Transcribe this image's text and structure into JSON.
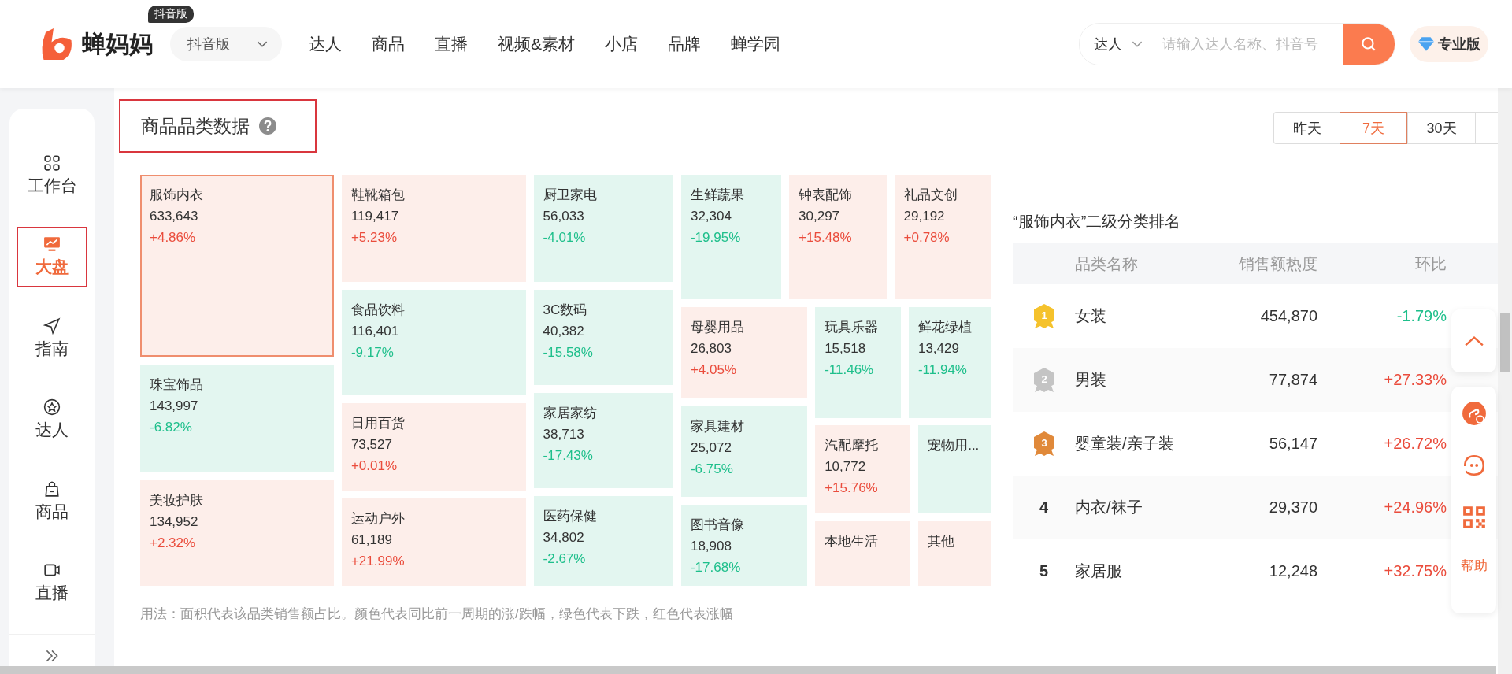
{
  "header": {
    "logo_text": "蝉妈妈",
    "logo_badge": "抖音版",
    "platform_select": "抖音版",
    "nav": [
      {
        "label": "达人"
      },
      {
        "label": "商品"
      },
      {
        "label": "直播"
      },
      {
        "label": "视频&素材"
      },
      {
        "label": "小店"
      },
      {
        "label": "品牌"
      },
      {
        "label": "蝉学园"
      }
    ],
    "search": {
      "scope": "达人",
      "placeholder": "请输入达人名称、抖音号"
    },
    "pro_button": "专业版"
  },
  "sidebar": {
    "items": [
      {
        "label": "工作台",
        "selected": false
      },
      {
        "label": "大盘",
        "selected": true
      },
      {
        "label": "指南",
        "selected": false
      },
      {
        "label": "达人",
        "selected": false
      },
      {
        "label": "商品",
        "selected": false
      },
      {
        "label": "直播",
        "selected": false
      }
    ]
  },
  "section": {
    "title": "商品品类数据",
    "highlighted": true,
    "periods": [
      {
        "label": "昨天",
        "selected": false
      },
      {
        "label": "7天",
        "selected": true
      },
      {
        "label": "30天",
        "selected": false
      }
    ]
  },
  "treemap": {
    "tiles": [
      {
        "name": "服饰内衣",
        "value": "633,643",
        "change": "+4.86%",
        "color": "#fdeeea",
        "selected": true
      },
      {
        "name": "珠宝饰品",
        "value": "143,997",
        "change": "-6.82%",
        "color": "#e3f6f0",
        "selected": false
      },
      {
        "name": "美妆护肤",
        "value": "134,952",
        "change": "+2.32%",
        "color": "#fdeeea",
        "selected": false
      },
      {
        "name": "鞋靴箱包",
        "value": "119,417",
        "change": "+5.23%",
        "color": "#fdeeea",
        "selected": false
      },
      {
        "name": "食品饮料",
        "value": "116,401",
        "change": "-9.17%",
        "color": "#e3f6f0",
        "selected": false
      },
      {
        "name": "日用百货",
        "value": "73,527",
        "change": "+0.01%",
        "color": "#fdeeea",
        "selected": false
      },
      {
        "name": "运动户外",
        "value": "61,189",
        "change": "+21.99%",
        "color": "#fdeeea",
        "selected": false
      },
      {
        "name": "厨卫家电",
        "value": "56,033",
        "change": "-4.01%",
        "color": "#e3f6f0",
        "selected": false
      },
      {
        "name": "3C数码",
        "value": "40,382",
        "change": "-15.58%",
        "color": "#e3f6f0",
        "selected": false
      },
      {
        "name": "家居家纺",
        "value": "38,713",
        "change": "-17.43%",
        "color": "#e3f6f0",
        "selected": false
      },
      {
        "name": "医药保健",
        "value": "34,802",
        "change": "-2.67%",
        "color": "#e3f6f0",
        "selected": false
      },
      {
        "name": "生鲜蔬果",
        "value": "32,304",
        "change": "-19.95%",
        "color": "#e3f6f0",
        "selected": false
      },
      {
        "name": "钟表配饰",
        "value": "30,297",
        "change": "+15.48%",
        "color": "#fdeeea",
        "selected": false
      },
      {
        "name": "礼品文创",
        "value": "29,192",
        "change": "+0.78%",
        "color": "#fdeeea",
        "selected": false
      },
      {
        "name": "母婴用品",
        "value": "26,803",
        "change": "+4.05%",
        "color": "#fdeeea",
        "selected": false
      },
      {
        "name": "家具建材",
        "value": "25,072",
        "change": "-6.75%",
        "color": "#e3f6f0",
        "selected": false
      },
      {
        "name": "图书音像",
        "value": "18,908",
        "change": "-17.68%",
        "color": "#e3f6f0",
        "selected": false
      },
      {
        "name": "玩具乐器",
        "value": "15,518",
        "change": "-11.46%",
        "color": "#e3f6f0",
        "selected": false
      },
      {
        "name": "鲜花绿植",
        "value": "13,429",
        "change": "-11.94%",
        "color": "#e3f6f0",
        "selected": false
      },
      {
        "name": "汽配摩托",
        "value": "10,772",
        "change": "+15.76%",
        "color": "#fdeeea",
        "selected": false
      },
      {
        "name": "宠物用...",
        "color": "#e3f6f0",
        "selected": false
      },
      {
        "name": "本地生活",
        "color": "#fdeeea",
        "selected": false
      },
      {
        "name": "其他",
        "color": "#fdeeea",
        "selected": false
      }
    ],
    "note": "用法：面积代表该品类销售额占比。颜色代表同比前一周期的涨/跌幅，绿色代表下跌，红色代表涨幅"
  },
  "ranking": {
    "title": "“服饰内衣”二级分类排名",
    "columns": [
      "品类名称",
      "销售额热度",
      "环比"
    ],
    "rows": [
      {
        "rank": "1",
        "kind": "medal",
        "color": "#f5c22c",
        "name": "女装",
        "value": "454,870",
        "change": "-1.79%"
      },
      {
        "rank": "2",
        "kind": "medal",
        "color": "#c4c4c4",
        "name": "男装",
        "value": "77,874",
        "change": "+27.33%"
      },
      {
        "rank": "3",
        "kind": "medal",
        "color": "#e0893a",
        "name": "婴童装/亲子装",
        "value": "56,147",
        "change": "+26.72%"
      },
      {
        "rank": "4",
        "kind": "number",
        "name": "内衣/袜子",
        "value": "29,370",
        "change": "+24.96%"
      },
      {
        "rank": "5",
        "kind": "number",
        "name": "家居服",
        "value": "12,248",
        "change": "+32.75%"
      }
    ]
  },
  "tools": {
    "help": "帮助"
  }
}
